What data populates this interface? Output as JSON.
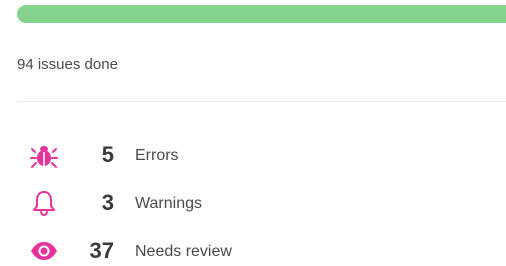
{
  "progress": {
    "fraction": 1.0,
    "color": "#85d38a",
    "done_text": "94 issues done"
  },
  "accent_color": "#e6339b",
  "stats": [
    {
      "icon": "bug-icon",
      "count": "5",
      "label": "Errors"
    },
    {
      "icon": "bell-icon",
      "count": "3",
      "label": "Warnings"
    },
    {
      "icon": "eye-icon",
      "count": "37",
      "label": "Needs review"
    }
  ]
}
